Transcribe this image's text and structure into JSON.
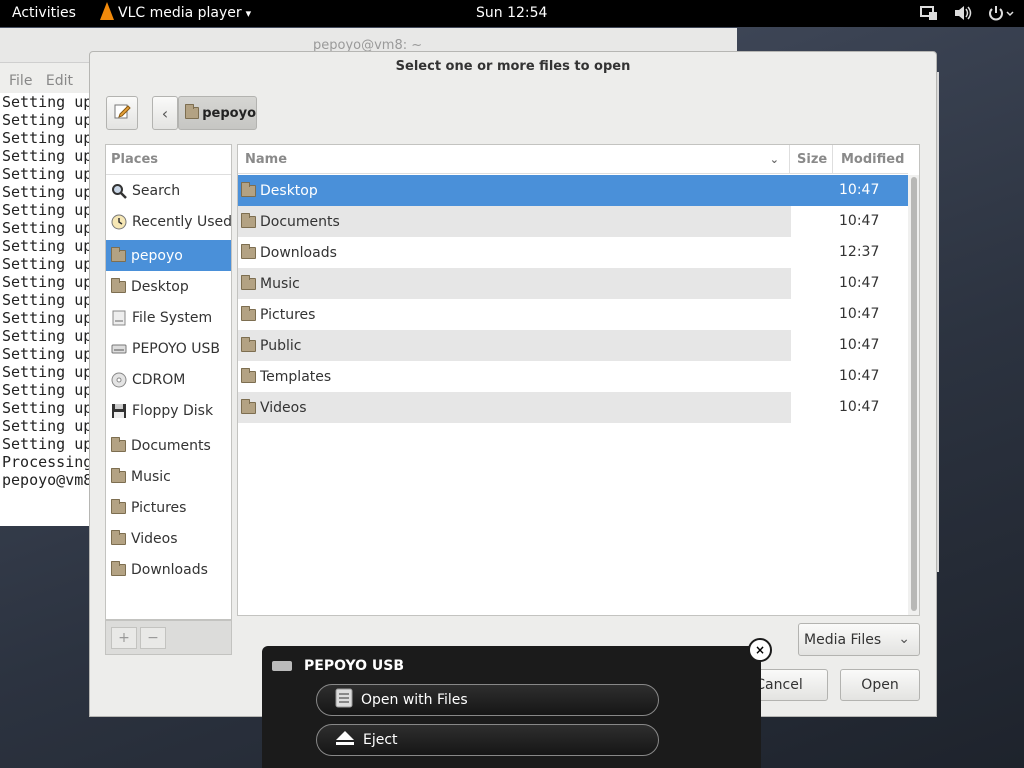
{
  "topbar": {
    "activities": "Activities",
    "app_name": "VLC media player",
    "app_menu_arrow": "▾",
    "clock": "Sun 12:54"
  },
  "terminal": {
    "title": "pepoyo@vm8: ~",
    "menu": [
      "File",
      "Edit"
    ],
    "lines": [
      "Setting up",
      "Setting up",
      "Setting up",
      "Setting up",
      "Setting up",
      "Setting up",
      "Setting up",
      "Setting up",
      "Setting up",
      "Setting up",
      "Setting up",
      "Setting up",
      "Setting up",
      "Setting up",
      "Setting up",
      "Setting up",
      "Setting up",
      "Setting up",
      "Setting up",
      "Setting up",
      "Processing",
      "pepoyo@vm8"
    ]
  },
  "dialog": {
    "title": "Select one or more files to open",
    "path_button": "pepoyo",
    "places_header": "Places",
    "places": [
      {
        "label": "Search",
        "icon": "search-icon"
      },
      {
        "label": "Recently Used",
        "icon": "clock-icon"
      },
      {
        "label": "pepoyo",
        "icon": "home-folder-icon",
        "selected": true
      },
      {
        "label": "Desktop",
        "icon": "folder-icon"
      },
      {
        "label": "File System",
        "icon": "drive-icon"
      },
      {
        "label": "PEPOYO USB",
        "icon": "usb-drive-icon"
      },
      {
        "label": "CDROM",
        "icon": "cd-icon"
      },
      {
        "label": "Floppy Disk",
        "icon": "floppy-icon"
      },
      {
        "label": "Documents",
        "icon": "folder-icon"
      },
      {
        "label": "Music",
        "icon": "folder-icon"
      },
      {
        "label": "Pictures",
        "icon": "folder-icon"
      },
      {
        "label": "Videos",
        "icon": "folder-icon"
      },
      {
        "label": "Downloads",
        "icon": "folder-icon"
      }
    ],
    "add_label": "+",
    "remove_label": "−",
    "columns": {
      "name": "Name",
      "size": "Size",
      "modified": "Modified"
    },
    "files": [
      {
        "name": "Desktop",
        "modified": "10:47",
        "selected": true
      },
      {
        "name": "Documents",
        "modified": "10:47"
      },
      {
        "name": "Downloads",
        "modified": "12:37"
      },
      {
        "name": "Music",
        "modified": "10:47"
      },
      {
        "name": "Pictures",
        "modified": "10:47"
      },
      {
        "name": "Public",
        "modified": "10:47"
      },
      {
        "name": "Templates",
        "modified": "10:47"
      },
      {
        "name": "Videos",
        "modified": "10:47"
      }
    ],
    "filter": "Media Files",
    "cancel": "Cancel",
    "open": "Open"
  },
  "notification": {
    "title": "PEPOYO USB",
    "open_with": "Open with Files",
    "eject": "Eject",
    "close": "×"
  },
  "colors": {
    "selection": "#4a90d9",
    "topbar": "#000000",
    "notification_bg": "#1b1b1b"
  }
}
